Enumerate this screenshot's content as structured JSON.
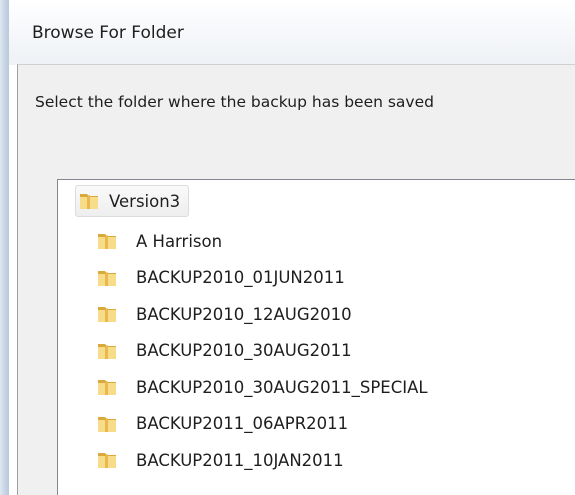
{
  "window": {
    "title": "Browse For Folder"
  },
  "dialog": {
    "instruction": "Select the folder where the backup has been saved"
  },
  "tree": {
    "root": {
      "label": "Version3",
      "icon": "folder-icon"
    },
    "children": [
      {
        "label": "A Harrison",
        "icon": "folder-icon"
      },
      {
        "label": "BACKUP2010_01JUN2011",
        "icon": "folder-icon"
      },
      {
        "label": "BACKUP2010_12AUG2010",
        "icon": "folder-icon"
      },
      {
        "label": "BACKUP2010_30AUG2011",
        "icon": "folder-icon"
      },
      {
        "label": "BACKUP2010_30AUG2011_SPECIAL",
        "icon": "folder-icon"
      },
      {
        "label": "BACKUP2011_06APR2011",
        "icon": "folder-icon"
      },
      {
        "label": "BACKUP2011_10JAN2011",
        "icon": "folder-icon"
      }
    ]
  },
  "colors": {
    "folder_light": "#f7dc8a",
    "folder_dark": "#d9a93c",
    "text": "#1e1e1e",
    "dialog_bg": "#f0f0f0"
  }
}
